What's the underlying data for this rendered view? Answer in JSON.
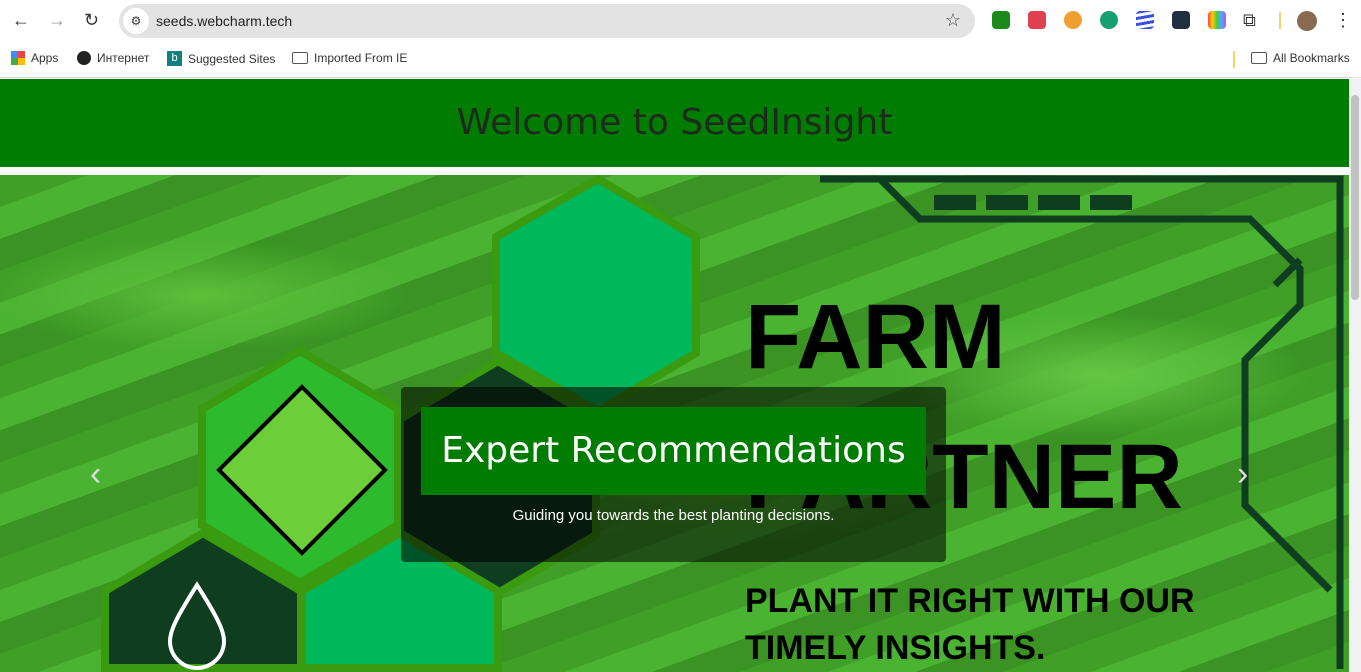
{
  "browser": {
    "url": "seeds.webcharm.tech",
    "extensions": [
      {
        "icon": "download-arrow-icon",
        "color": "#1a8a1a"
      },
      {
        "icon": "pocket-icon",
        "color": "#e04050"
      },
      {
        "icon": "medal-icon",
        "color": "#f0a030"
      },
      {
        "icon": "grammarly-icon",
        "color": "#15a070"
      },
      {
        "icon": "stripes-icon",
        "color": "#3a50e0"
      },
      {
        "icon": "compass-icon",
        "color": "#203040"
      },
      {
        "icon": "palette-icon",
        "color": "#e040a0"
      }
    ],
    "bookmarks": [
      {
        "label": "Apps",
        "icon": "apps-grid-icon"
      },
      {
        "label": "Интернет",
        "icon": "globe-icon"
      },
      {
        "label": "Suggested Sites",
        "icon": "bing-icon"
      },
      {
        "label": "Imported From IE",
        "icon": "folder-icon"
      }
    ],
    "all_bookmarks": "All Bookmarks"
  },
  "page": {
    "header_title": "Welcome to SeedInsight",
    "hero": {
      "line1": "FARM",
      "line2": "PARTNER",
      "tagline1": "PLANT IT RIGHT WITH OUR",
      "tagline2": "TIMELY INSIGHTS.",
      "caption_title": "Expert Recommendations",
      "caption_text": "Guiding you towards the best planting decisions.",
      "prev": "‹",
      "next": "›"
    }
  },
  "colors": {
    "brand": "#007d00",
    "hex_light": "#00b85c",
    "hex_dark": "#0f3d1f",
    "hex_lime": "#2dbb2d"
  }
}
